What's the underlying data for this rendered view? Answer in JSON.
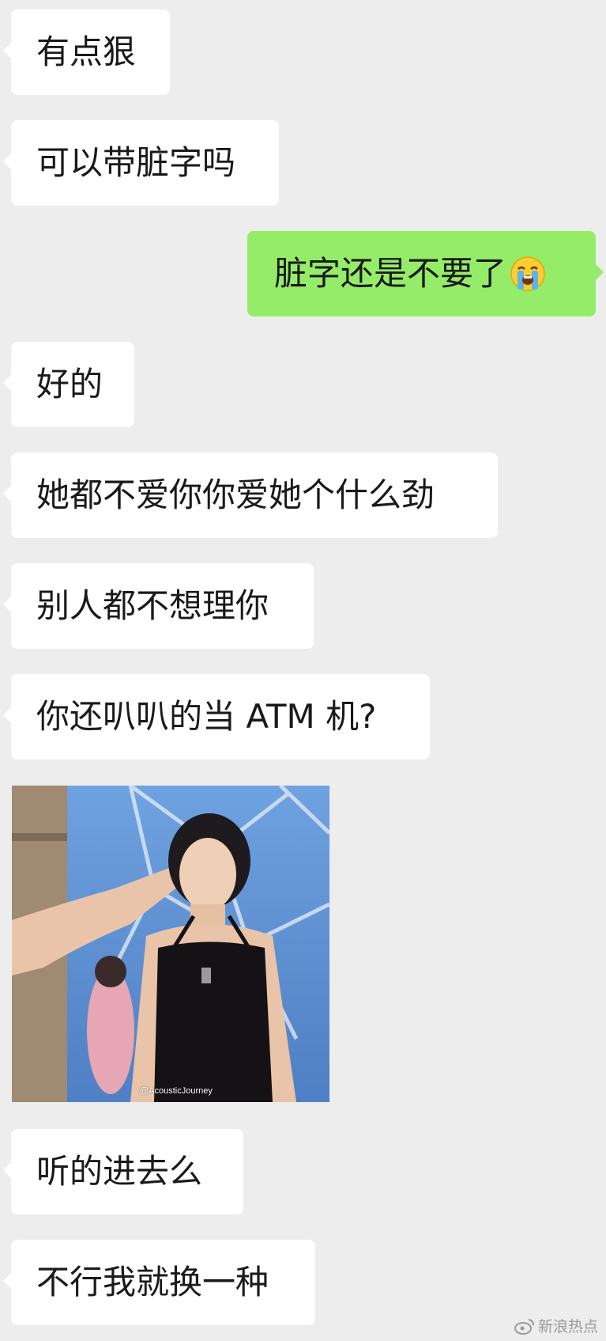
{
  "messages": [
    {
      "side": "in",
      "text": "有点狠"
    },
    {
      "side": "in",
      "text": "可以带脏字吗"
    },
    {
      "side": "out",
      "text": "脏字还是不要了",
      "emoji": "loudly-crying-face-emoji"
    },
    {
      "side": "in",
      "text": "好的"
    },
    {
      "side": "in",
      "text": "她都不爱你你爱她个什么劲"
    },
    {
      "side": "in",
      "text": "别人都不想理你"
    },
    {
      "side": "in",
      "text": "你还叭叭的当 ATM 机?"
    },
    {
      "side": "in",
      "type": "image",
      "image_watermark": "@AcousticJourney"
    },
    {
      "side": "in",
      "text": "听的进去么"
    },
    {
      "side": "in",
      "text": "不行我就换一种"
    }
  ],
  "footer_watermark": {
    "text": "新浪热点",
    "icon": "weibo-logo-icon"
  },
  "colors": {
    "background": "#ededed",
    "incoming_bubble": "#ffffff",
    "outgoing_bubble": "#95ec69"
  }
}
